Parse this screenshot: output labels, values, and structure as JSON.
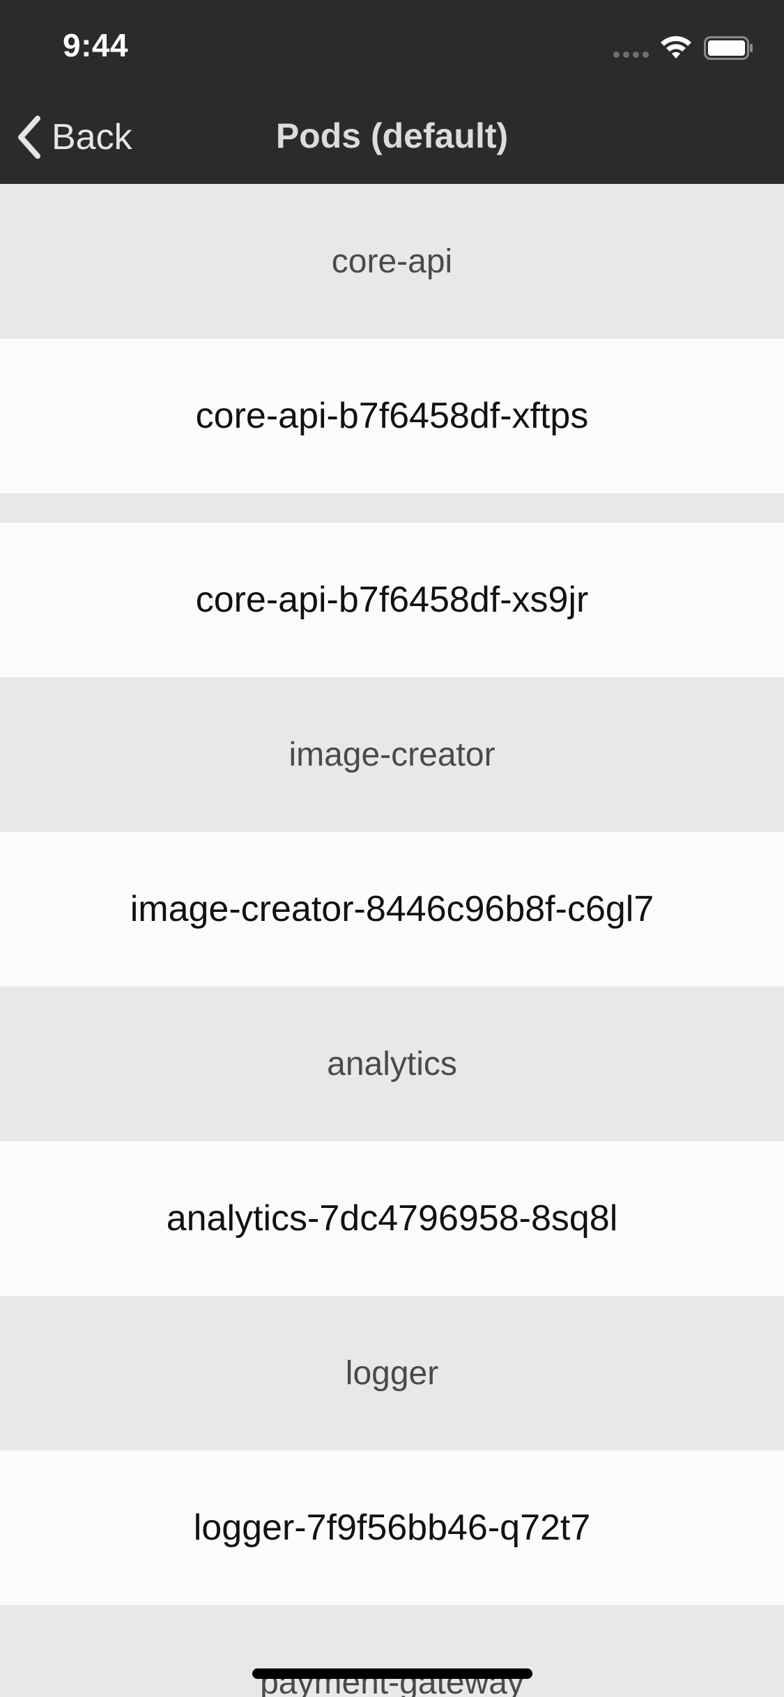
{
  "status_bar": {
    "time": "9:44",
    "signal_icon": "cellular-signal-icon",
    "wifi_icon": "wifi-icon",
    "battery_icon": "battery-icon"
  },
  "nav": {
    "back_label": "Back",
    "back_icon": "chevron-left-icon",
    "title": "Pods (default)"
  },
  "colors": {
    "top_bar": "#2b2b2b",
    "section_background": "#e8e8e8",
    "row_background": "#fbfbfb"
  },
  "sections": [
    {
      "header": "core-api",
      "pods": [
        "core-api-b7f6458df-xftps",
        "core-api-b7f6458df-xs9jr"
      ]
    },
    {
      "header": "image-creator",
      "pods": [
        "image-creator-8446c96b8f-c6gl7"
      ]
    },
    {
      "header": "analytics",
      "pods": [
        "analytics-7dc4796958-8sq8l"
      ]
    },
    {
      "header": "logger",
      "pods": [
        "logger-7f9f56bb46-q72t7"
      ]
    },
    {
      "header": "payment-gateway",
      "pods": []
    }
  ]
}
